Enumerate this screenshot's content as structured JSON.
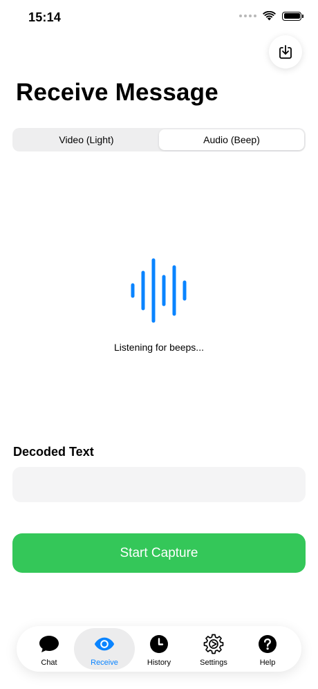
{
  "status": {
    "time": "15:14"
  },
  "page": {
    "title": "Receive Message"
  },
  "modes": [
    {
      "label": "Video (Light)",
      "active": false
    },
    {
      "label": "Audio (Beep)",
      "active": true
    }
  ],
  "listening": {
    "text": "Listening for beeps..."
  },
  "decoded": {
    "label": "Decoded Text",
    "value": ""
  },
  "capture": {
    "label": "Start Capture"
  },
  "tabs": [
    {
      "label": "Chat",
      "icon": "chat-bubble-icon"
    },
    {
      "label": "Receive",
      "icon": "eye-icon",
      "active": true
    },
    {
      "label": "History",
      "icon": "clock-icon"
    },
    {
      "label": "Settings",
      "icon": "gear-icon"
    },
    {
      "label": "Help",
      "icon": "question-icon"
    }
  ],
  "colors": {
    "accent": "#0a84ff",
    "capture": "#34c759",
    "waveform": "#0a84ff"
  }
}
